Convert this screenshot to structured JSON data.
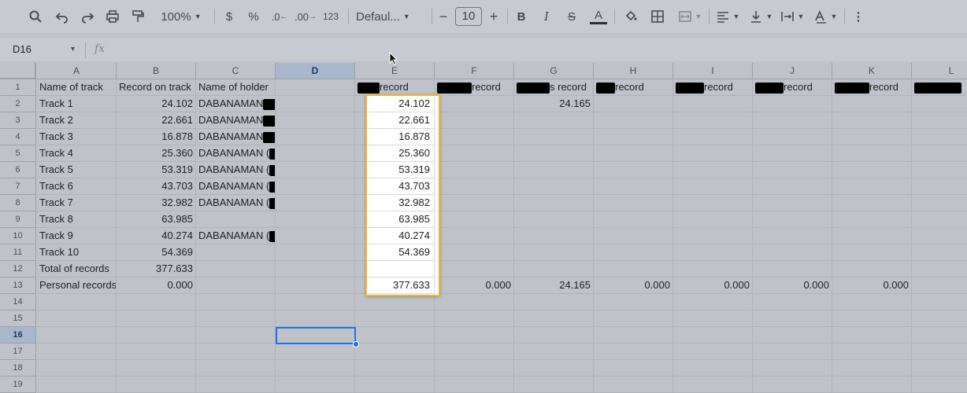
{
  "toolbar": {
    "zoom": "100%",
    "currency": "$",
    "percent": "%",
    "dec_decrease": ".0",
    "dec_increase": ".00",
    "number_format": "123",
    "font": "Defaul...",
    "minus": "−",
    "font_size": "10",
    "plus": "+",
    "bold": "B",
    "italic": "I",
    "strike": "S",
    "text_color": "A",
    "more": "⋮"
  },
  "formula_bar": {
    "name_box": "D16",
    "fx": "fx",
    "content": ""
  },
  "columns": [
    "A",
    "B",
    "C",
    "D",
    "E",
    "F",
    "G",
    "H",
    "I",
    "J",
    "K",
    "L"
  ],
  "selected_column": "D",
  "rows": [
    "1",
    "2",
    "3",
    "4",
    "5",
    "6",
    "7",
    "8",
    "9",
    "10",
    "11",
    "12",
    "13",
    "14",
    "15",
    "16",
    "17",
    "18",
    "19"
  ],
  "selected_row": "16",
  "cells": {
    "A": [
      "Name of track",
      "Track 1",
      "Track 2",
      "Track 3",
      "Track 4",
      "Track 5",
      "Track 6",
      "Track 7",
      "Track 8",
      "Track 9",
      "Track 10",
      "Total of records",
      "Personal records"
    ],
    "B": [
      "Record on track",
      "24.102",
      "22.661",
      "16.878",
      "25.360",
      "53.319",
      "43.703",
      "32.982",
      "63.985",
      "40.274",
      "54.369",
      "377.633",
      "0.000"
    ],
    "C": [
      "Name of holder",
      "DABANAMAN",
      "DABANAMAN",
      "DABANAMAN",
      "DABANAMAN (",
      "DABANAMAN (",
      "DABANAMAN (",
      "DABANAMAN (",
      "",
      "DABANAMAN (",
      "",
      "",
      ""
    ],
    "C_suffix": [
      "",
      "",
      "",
      "",
      "",
      "",
      "",
      ")",
      "",
      ")",
      "",
      "",
      ""
    ],
    "E1": "record",
    "F1": "record",
    "G1": "s record",
    "H1": "record",
    "I1": "record",
    "J1": "record",
    "K1": "record",
    "G2": "24.165",
    "row13": {
      "F": "0.000",
      "G": "24.165",
      "H": "0.000",
      "I": "0.000",
      "J": "0.000",
      "K": "0.000"
    }
  },
  "overlay_values": [
    "24.102",
    "22.661",
    "16.878",
    "25.360",
    "53.319",
    "43.703",
    "32.982",
    "63.985",
    "40.274",
    "54.369",
    "",
    "377.633"
  ]
}
